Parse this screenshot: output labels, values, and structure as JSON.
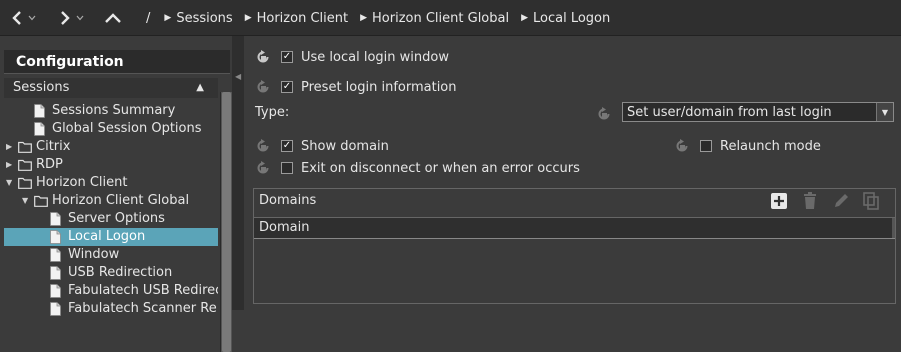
{
  "nav": {
    "back_icon": "chevron-left-icon",
    "forward_icon": "chevron-right-icon",
    "up_icon": "chevron-up-icon",
    "separator": "/"
  },
  "breadcrumb": [
    "Sessions",
    "Horizon Client",
    "Horizon Client Global",
    "Local Logon"
  ],
  "sidebar": {
    "title": "Configuration",
    "section": "Sessions",
    "tree": [
      {
        "label": "Sessions Summary",
        "type": "file",
        "depth": 1
      },
      {
        "label": "Global Session Options",
        "type": "file",
        "depth": 1
      },
      {
        "label": "Citrix",
        "type": "folder",
        "depth": 0,
        "expanded": false
      },
      {
        "label": "RDP",
        "type": "folder",
        "depth": 0,
        "expanded": false
      },
      {
        "label": "Horizon Client",
        "type": "folder",
        "depth": 0,
        "expanded": true
      },
      {
        "label": "Horizon Client Global",
        "type": "folder",
        "depth": 1,
        "expanded": true
      },
      {
        "label": "Server Options",
        "type": "file",
        "depth": 2
      },
      {
        "label": "Local Logon",
        "type": "file",
        "depth": 2,
        "selected": true
      },
      {
        "label": "Window",
        "type": "file",
        "depth": 2
      },
      {
        "label": "USB Redirection",
        "type": "file",
        "depth": 2
      },
      {
        "label": "Fabulatech USB Redirec",
        "type": "file",
        "depth": 2
      },
      {
        "label": "Fabulatech Scanner Re",
        "type": "file",
        "depth": 2
      }
    ]
  },
  "form": {
    "use_local_login": {
      "label": "Use local login window",
      "checked": true
    },
    "preset_login": {
      "label": "Preset login information",
      "checked": true
    },
    "type_label": "Type:",
    "type_value": "Set user/domain from last login",
    "show_domain": {
      "label": "Show domain",
      "checked": true
    },
    "relaunch_mode": {
      "label": "Relaunch mode",
      "checked": false
    },
    "exit_on_disconnect": {
      "label": "Exit on disconnect or when an error occurs",
      "checked": false
    }
  },
  "domains": {
    "title": "Domains",
    "column": "Domain",
    "tools": [
      "add-icon",
      "delete-icon",
      "edit-icon",
      "copy-icon"
    ],
    "rows": []
  },
  "colors": {
    "background": "#3b3b3b",
    "selection": "#5ba4b8",
    "topbar": "#2f2f2f"
  }
}
